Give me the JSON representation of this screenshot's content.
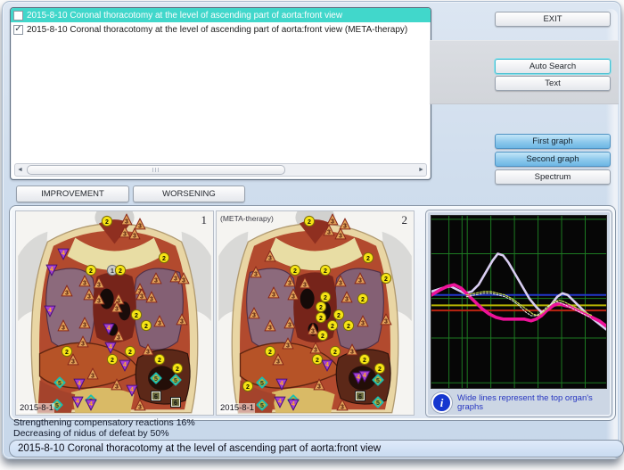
{
  "list": {
    "items": [
      {
        "label": "2015-8-10  Coronal thoracotomy at the level of ascending part of aorta:front view",
        "checked": false,
        "selected": true
      },
      {
        "label": "2015-8-10  Coronal thoracotomy at the level of ascending part of aorta:front view  (META-therapy)",
        "checked": true,
        "selected": false
      }
    ]
  },
  "buttons": {
    "exit": "EXIT",
    "auto_search": "Auto Search",
    "text": "Text",
    "first_graph": "First graph",
    "second_graph": "Second graph",
    "spectrum": "Spectrum",
    "improvement": "IMPROVEMENT",
    "worsening": "WORSENING"
  },
  "marker_types": {
    "c1": {
      "shape": "circle",
      "fill": "#c9c9c7",
      "stroke": "#6a7078",
      "label": "1",
      "text": "#30343a"
    },
    "c2": {
      "shape": "circle",
      "fill": "#f6e414",
      "stroke": "#7c6c08",
      "label": "2",
      "text": "#141400"
    },
    "t3": {
      "shape": "triangle-up",
      "fill": "#e0a058",
      "stroke": "#88281a",
      "label": "3",
      "text": "#4c1608"
    },
    "t4": {
      "shape": "triangle-down",
      "fill": "#a440d2",
      "stroke": "#481078",
      "label": "4",
      "text": "#ffb224"
    },
    "d5": {
      "shape": "diamond",
      "fill": "#b5ae3e",
      "stroke": "#18beb2",
      "label": "5",
      "text": "#123a2a"
    },
    "s6": {
      "shape": "square",
      "fill": "#6a6a3c",
      "stroke": "#efefe0",
      "label": "6",
      "text": "#111111"
    }
  },
  "images": [
    {
      "index": "1",
      "annotation": "",
      "timestamp": "2015-8-1",
      "markers": [
        [
          "c2",
          46,
          5
        ],
        [
          "t3",
          56,
          4
        ],
        [
          "t3",
          63,
          6
        ],
        [
          "t3",
          55,
          10
        ],
        [
          "t3",
          60,
          11
        ],
        [
          "t4",
          24,
          21
        ],
        [
          "c2",
          75,
          23
        ],
        [
          "t4",
          18,
          29
        ],
        [
          "c2",
          38,
          29
        ],
        [
          "c1",
          49,
          29
        ],
        [
          "c2",
          53,
          29
        ],
        [
          "t3",
          81,
          32
        ],
        [
          "t3",
          35,
          34
        ],
        [
          "t3",
          42,
          35
        ],
        [
          "t3",
          71,
          33
        ],
        [
          "t3",
          85,
          33
        ],
        [
          "t3",
          63,
          38
        ],
        [
          "t3",
          26,
          39
        ],
        [
          "t3",
          37,
          41
        ],
        [
          "t3",
          42,
          43
        ],
        [
          "t3",
          52,
          43
        ],
        [
          "t3",
          64,
          41
        ],
        [
          "t3",
          69,
          42
        ],
        [
          "t4",
          17,
          49
        ],
        [
          "t3",
          51,
          47
        ],
        [
          "c2",
          61,
          51
        ],
        [
          "t3",
          24,
          56
        ],
        [
          "t3",
          35,
          55
        ],
        [
          "c2",
          66,
          56
        ],
        [
          "t3",
          73,
          54
        ],
        [
          "t3",
          84,
          53
        ],
        [
          "t4",
          47,
          58
        ],
        [
          "t3",
          52,
          61
        ],
        [
          "t3",
          34,
          64
        ],
        [
          "t4",
          48,
          67
        ],
        [
          "t3",
          67,
          68
        ],
        [
          "c2",
          26,
          69
        ],
        [
          "c2",
          58,
          69
        ],
        [
          "c2",
          49,
          73
        ],
        [
          "c2",
          73,
          73
        ],
        [
          "t3",
          29,
          73
        ],
        [
          "c2",
          82,
          77
        ],
        [
          "t4",
          55,
          76
        ],
        [
          "t3",
          39,
          80
        ],
        [
          "d5",
          22,
          84
        ],
        [
          "t4",
          32,
          85
        ],
        [
          "t3",
          51,
          85
        ],
        [
          "t4",
          59,
          88
        ],
        [
          "d5",
          71,
          82
        ],
        [
          "d5",
          81,
          83
        ],
        [
          "s6",
          71,
          91
        ],
        [
          "d5",
          38,
          93
        ],
        [
          "t4",
          31,
          94
        ],
        [
          "s6",
          81,
          94
        ],
        [
          "d5",
          21,
          95
        ],
        [
          "t4",
          38,
          95
        ],
        [
          "t3",
          63,
          95
        ]
      ]
    },
    {
      "index": "2",
      "annotation": "(META-therapy)",
      "timestamp": "2015-8-1",
      "markers": [
        [
          "c2",
          47,
          5
        ],
        [
          "t3",
          59,
          4
        ],
        [
          "t3",
          65,
          6
        ],
        [
          "t3",
          57,
          9
        ],
        [
          "t3",
          63,
          11
        ],
        [
          "t3",
          27,
          22
        ],
        [
          "c2",
          77,
          23
        ],
        [
          "t3",
          20,
          30
        ],
        [
          "c2",
          40,
          29
        ],
        [
          "c2",
          55,
          29
        ],
        [
          "c2",
          86,
          33
        ],
        [
          "t3",
          37,
          34
        ],
        [
          "t3",
          45,
          35
        ],
        [
          "t3",
          63,
          34
        ],
        [
          "t3",
          73,
          33
        ],
        [
          "t3",
          29,
          40
        ],
        [
          "t3",
          39,
          41
        ],
        [
          "c2",
          55,
          42
        ],
        [
          "t3",
          66,
          42
        ],
        [
          "c2",
          74,
          43
        ],
        [
          "t3",
          19,
          50
        ],
        [
          "c2",
          53,
          47
        ],
        [
          "t3",
          27,
          56
        ],
        [
          "t3",
          37,
          55
        ],
        [
          "c2",
          53,
          52
        ],
        [
          "c2",
          62,
          51
        ],
        [
          "c2",
          67,
          56
        ],
        [
          "t3",
          74,
          54
        ],
        [
          "t3",
          86,
          53
        ],
        [
          "t3",
          49,
          58
        ],
        [
          "c2",
          59,
          56
        ],
        [
          "c2",
          54,
          61
        ],
        [
          "c2",
          60,
          69
        ],
        [
          "t3",
          36,
          65
        ],
        [
          "c2",
          27,
          69
        ],
        [
          "t3",
          50,
          67
        ],
        [
          "t3",
          69,
          68
        ],
        [
          "c2",
          75,
          73
        ],
        [
          "c2",
          83,
          77
        ],
        [
          "c2",
          51,
          73
        ],
        [
          "t3",
          31,
          73
        ],
        [
          "t4",
          56,
          76
        ],
        [
          "t3",
          52,
          85
        ],
        [
          "t4",
          33,
          85
        ],
        [
          "c2",
          16,
          86
        ],
        [
          "d5",
          23,
          84
        ],
        [
          "t4",
          72,
          82
        ],
        [
          "d5",
          82,
          83
        ],
        [
          "t4",
          75,
          81
        ],
        [
          "s6",
          73,
          91
        ],
        [
          "d5",
          39,
          93
        ],
        [
          "t4",
          32,
          94
        ],
        [
          "d5",
          82,
          94
        ],
        [
          "d5",
          23,
          95
        ],
        [
          "t4",
          39,
          95
        ],
        [
          "t3",
          64,
          95
        ]
      ]
    }
  ],
  "graph_note": {
    "icon": "info-icon",
    "text": "Wide lines represent the top organ's graphs"
  },
  "status": {
    "line1": "Strengthening compensatory reactions 16%",
    "line2": "Decreasing of nidus of defeat by 50%"
  },
  "footer": {
    "title": "2015-8-10 Coronal thoracotomy at the level of ascending part of aorta:front view"
  },
  "chart_data": {
    "type": "line",
    "title": "",
    "xlabel": "",
    "ylabel": "",
    "background": "#060606",
    "grid": true,
    "grid_color": "#1d7a22",
    "x_gridlines_pct": [
      10,
      17.5,
      20.5,
      34,
      47.5,
      61,
      74.5,
      88
    ],
    "y_gridlines_pct": [
      2,
      22,
      48,
      71,
      97
    ],
    "legend_note": "Wide lines represent the top organ's graphs",
    "series": [
      {
        "name": "baseline-blue",
        "color": "#2336cc",
        "width": 2,
        "style": "solid",
        "points": [
          [
            0,
            46
          ],
          [
            100,
            46
          ]
        ]
      },
      {
        "name": "baseline-yellow",
        "color": "#b8b402",
        "width": 2,
        "style": "solid",
        "points": [
          [
            0,
            52
          ],
          [
            100,
            52
          ]
        ]
      },
      {
        "name": "baseline-red",
        "color": "#bb2412",
        "width": 2,
        "style": "solid",
        "points": [
          [
            0,
            55
          ],
          [
            100,
            55
          ]
        ]
      },
      {
        "name": "organ-graph-1-wide-white",
        "color": "#d9cef2",
        "width": 2.6,
        "style": "solid",
        "points": [
          [
            0,
            44
          ],
          [
            6,
            42
          ],
          [
            11,
            41
          ],
          [
            15,
            43
          ],
          [
            19,
            45
          ],
          [
            23,
            44
          ],
          [
            27,
            40
          ],
          [
            31,
            33
          ],
          [
            35,
            26
          ],
          [
            38,
            22
          ],
          [
            41,
            23
          ],
          [
            44,
            27
          ],
          [
            48,
            34
          ],
          [
            52,
            41
          ],
          [
            56,
            48
          ],
          [
            60,
            53
          ],
          [
            63,
            56
          ],
          [
            66,
            55
          ],
          [
            69,
            51
          ],
          [
            72,
            47
          ],
          [
            75,
            45
          ],
          [
            78,
            46
          ],
          [
            82,
            50
          ],
          [
            86,
            54
          ],
          [
            90,
            58
          ],
          [
            95,
            62
          ],
          [
            100,
            66
          ]
        ]
      },
      {
        "name": "organ-graph-2-wide-magenta",
        "color": "#ee1299",
        "width": 3.6,
        "style": "solid",
        "points": [
          [
            0,
            46
          ],
          [
            5,
            43
          ],
          [
            9,
            41
          ],
          [
            13,
            40
          ],
          [
            17,
            42
          ],
          [
            21,
            46
          ],
          [
            25,
            50
          ],
          [
            29,
            54
          ],
          [
            33,
            57
          ],
          [
            37,
            59
          ],
          [
            41,
            60
          ],
          [
            45,
            60
          ],
          [
            49,
            60
          ],
          [
            53,
            60
          ],
          [
            57,
            61
          ],
          [
            60,
            60
          ],
          [
            63,
            58
          ],
          [
            66,
            55
          ],
          [
            70,
            52
          ],
          [
            73,
            51
          ],
          [
            76,
            52
          ],
          [
            80,
            53
          ],
          [
            84,
            55
          ],
          [
            88,
            57
          ],
          [
            92,
            59
          ],
          [
            96,
            61
          ],
          [
            100,
            64
          ]
        ]
      },
      {
        "name": "etalon-dashed-green",
        "color": "#bdd24f",
        "width": 1.3,
        "style": "dashed",
        "points": [
          [
            20,
            46
          ],
          [
            25,
            45
          ],
          [
            30,
            44
          ],
          [
            34,
            44
          ],
          [
            38,
            45
          ],
          [
            42,
            46
          ],
          [
            46,
            48
          ],
          [
            50,
            51
          ],
          [
            54,
            54
          ],
          [
            58,
            57
          ],
          [
            61,
            58
          ],
          [
            64,
            56
          ],
          [
            67,
            53
          ],
          [
            70,
            50
          ],
          [
            73,
            49
          ],
          [
            76,
            50
          ],
          [
            80,
            52
          ],
          [
            84,
            54
          ],
          [
            88,
            56
          ],
          [
            92,
            58
          ]
        ]
      },
      {
        "name": "etalon-dashed-white",
        "color": "#e6e6e6",
        "width": 1,
        "style": "dashed",
        "points": [
          [
            20,
            47
          ],
          [
            25,
            46
          ],
          [
            30,
            45
          ],
          [
            34,
            45
          ],
          [
            38,
            46
          ],
          [
            42,
            47
          ],
          [
            46,
            49
          ],
          [
            50,
            52
          ],
          [
            54,
            56
          ],
          [
            57,
            58
          ],
          [
            60,
            58
          ],
          [
            63,
            56
          ],
          [
            66,
            53
          ],
          [
            69,
            51
          ],
          [
            72,
            50
          ],
          [
            75,
            51
          ],
          [
            79,
            53
          ],
          [
            83,
            55
          ],
          [
            87,
            57
          ],
          [
            91,
            59
          ]
        ]
      }
    ]
  }
}
